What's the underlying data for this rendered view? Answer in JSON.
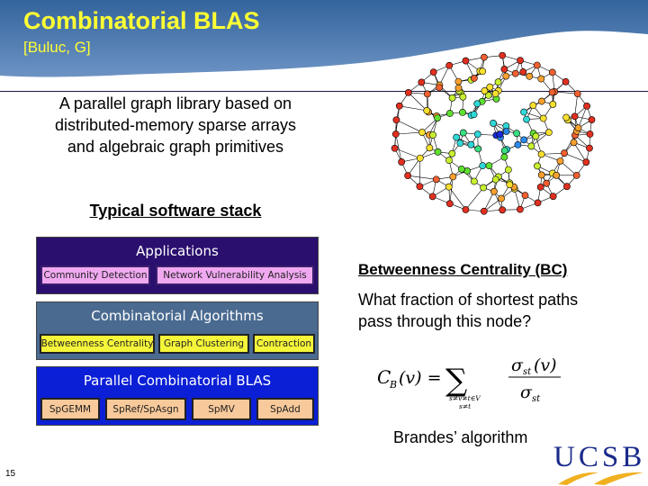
{
  "header": {
    "title": "Combinatorial BLAS",
    "subtitle": "[Buluc, G]",
    "gradient_top": "#3a6aa0",
    "gradient_bottom": "#6a90c0",
    "title_color": "#ffff33"
  },
  "description": {
    "line1": "A parallel graph library based on",
    "line2": "distributed-memory sparse arrays",
    "line3": "and algebraic graph primitives"
  },
  "stack": {
    "heading": "Typical software stack",
    "layers": [
      {
        "title": "Applications",
        "color": "#2a0f6e",
        "items": [
          "Community Detection",
          "Network Vulnerability Analysis"
        ]
      },
      {
        "title": "Combinatorial Algorithms",
        "color": "#4a6a90",
        "items": [
          "Betweenness Centrality",
          "Graph Clustering",
          "Contraction"
        ]
      },
      {
        "title": "Parallel Combinatorial BLAS",
        "color": "#0b1fd6",
        "items": [
          "SpGEMM",
          "SpRef/SpAsgn",
          "SpMV",
          "SpAdd"
        ]
      }
    ]
  },
  "graph_image": {
    "description": "graph network with nodes colored by betweenness centrality",
    "icon": "graph-network-icon"
  },
  "bc": {
    "heading": "Betweenness Centrality (BC)",
    "question_line1": "What fraction of shortest paths",
    "question_line2": "pass through this node?",
    "formula": {
      "lhs": "C",
      "lhs_sub": "B",
      "lhs_arg": "(v) =",
      "sum": "∑",
      "sum_cond1": "s≠v≠t∈V",
      "sum_cond2": "s≠t",
      "numerator": "σ",
      "numerator_sub": "st",
      "numerator_arg": "(v)",
      "denominator": "σ",
      "denominator_sub": "st"
    },
    "algorithm": "Brandes’ algorithm"
  },
  "footer": {
    "page_number": "15",
    "logo_text": "UCSB",
    "logo_color": "#1a2a8a",
    "logo_wave_color": "#f0b020"
  }
}
